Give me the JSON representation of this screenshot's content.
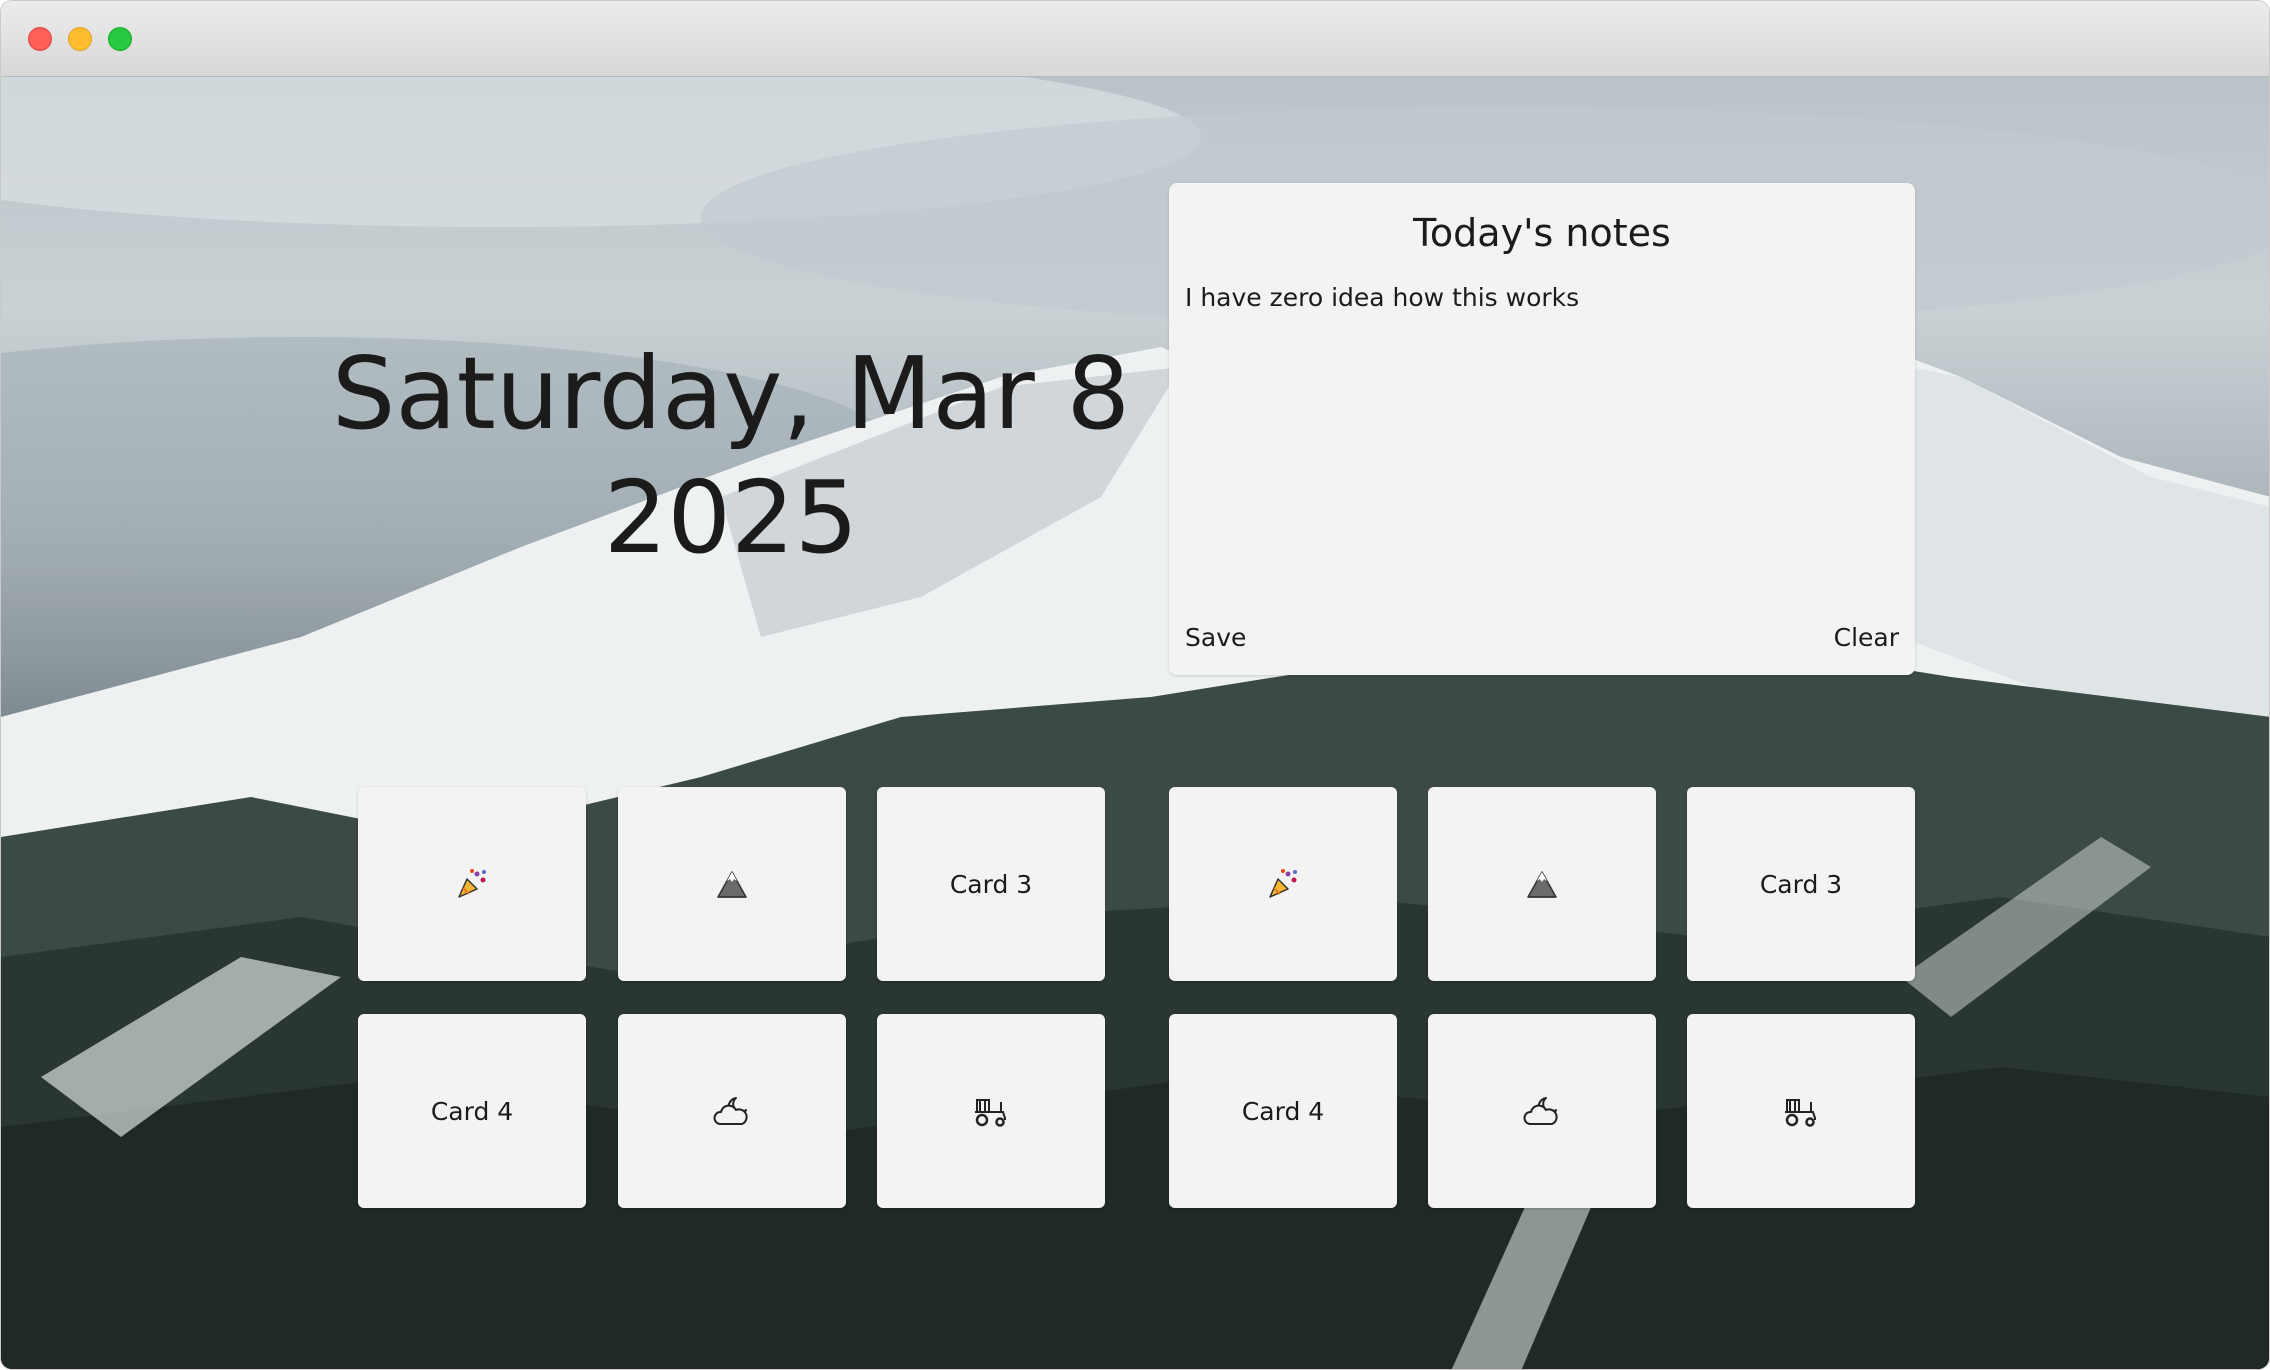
{
  "window": {
    "controls": [
      "close",
      "minimize",
      "maximize"
    ]
  },
  "date": {
    "line1": "Saturday, Mar 8",
    "line2": "2025"
  },
  "notes": {
    "title": "Today's notes",
    "body": "I have zero idea how this works",
    "save_label": "Save",
    "clear_label": "Clear"
  },
  "cards": [
    {
      "type": "icon",
      "icon": "party-popper-icon"
    },
    {
      "type": "icon",
      "icon": "mountain-icon"
    },
    {
      "type": "text",
      "label": "Card 3"
    },
    {
      "type": "icon",
      "icon": "party-popper-icon"
    },
    {
      "type": "icon",
      "icon": "mountain-icon"
    },
    {
      "type": "text",
      "label": "Card 3"
    },
    {
      "type": "text",
      "label": "Card 4"
    },
    {
      "type": "icon",
      "icon": "weather-moon-cloud-icon"
    },
    {
      "type": "icon",
      "icon": "tractor-icon"
    },
    {
      "type": "text",
      "label": "Card 4"
    },
    {
      "type": "icon",
      "icon": "weather-moon-cloud-icon"
    },
    {
      "type": "icon",
      "icon": "tractor-icon"
    }
  ],
  "colors": {
    "card_bg": "#f3f3f3",
    "text": "#1b1b1b",
    "close": "#fe5f57",
    "minimize": "#febc2e",
    "maximize": "#28c840"
  }
}
